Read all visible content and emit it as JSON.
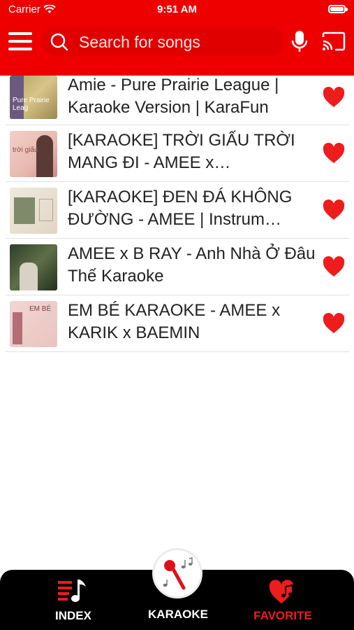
{
  "status_bar": {
    "carrier": "Carrier",
    "time": "9:51 AM",
    "battery_level": 1.0
  },
  "header": {
    "background_color": "#ee0000",
    "search_placeholder": "Search for songs",
    "icons": {
      "menu": "menu-icon",
      "search": "search-icon",
      "mic": "microphone-icon",
      "cast": "cast-icon"
    }
  },
  "songs": [
    {
      "title": "Amie - Pure Prairie League | Karaoke Version | KaraFun",
      "thumb_text": "Pure Prairie Leag",
      "favorited": true
    },
    {
      "title": "[KARAOKE] TRỜI GIẤU TRỜI MANG ĐI - AMEE x…",
      "thumb_text": "trời giấu",
      "favorited": true
    },
    {
      "title": "[KARAOKE] ĐEN ĐÁ KHÔNG ĐƯỜNG - AMEE | Instrum…",
      "thumb_text": "",
      "favorited": true
    },
    {
      "title": "AMEE x B RAY - Anh Nhà Ở Đâu Thế  Karaoke",
      "thumb_text": "",
      "favorited": true
    },
    {
      "title": "EM BÉ KARAOKE - AMEE x KARIK x BAEMIN",
      "thumb_text": "EM BÉ",
      "favorited": true
    }
  ],
  "tabs": {
    "index": "INDEX",
    "karaoke": "KARAOKE",
    "favorite": "FAVORITE",
    "active": "favorite",
    "active_color": "#ee1c1c"
  }
}
